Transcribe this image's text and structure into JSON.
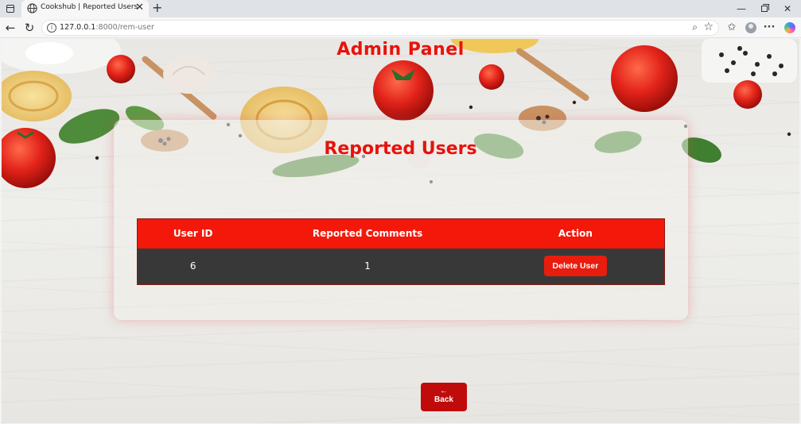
{
  "browser": {
    "tab_title": "Cookshub | Reported Users",
    "url_host": "127.0.0.1",
    "url_path": ":8000/rem-user",
    "icons": [
      "sidebar-icon",
      "globe-icon",
      "close-icon",
      "plus-icon",
      "minimize-icon",
      "restore-icon",
      "back-arrow-icon",
      "reload-icon",
      "info-icon",
      "zoom-icon",
      "star-icon",
      "favorites-icon",
      "profile-icon",
      "more-icon",
      "copilot-icon"
    ]
  },
  "page": {
    "admin_title": "Admin Panel",
    "section_title": "Reported Users",
    "table": {
      "headers": [
        "User ID",
        "Reported Comments",
        "Action"
      ],
      "rows": [
        {
          "user_id": "6",
          "reported_comments": "1",
          "action_label": "Delete User"
        }
      ]
    },
    "back_arrow": "←",
    "back_label": "Back"
  },
  "colors": {
    "accent_red": "#e8120c",
    "header_red": "#f3180a",
    "row_dark": "#383838",
    "back_button": "#c00b0b"
  }
}
